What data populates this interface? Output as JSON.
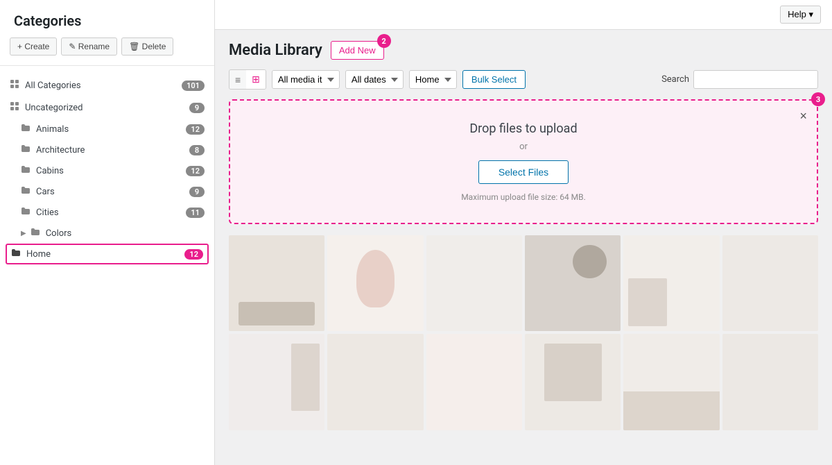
{
  "topbar": {
    "help_label": "Help ▾"
  },
  "sidebar": {
    "title": "Categories",
    "buttons": {
      "create": "+ Create",
      "rename": "✎ Rename",
      "delete": "🗑 Delete"
    },
    "items": [
      {
        "id": "all-categories",
        "label": "All Categories",
        "count": "101",
        "count_color": "gray",
        "indent": false,
        "has_arrow": false
      },
      {
        "id": "uncategorized",
        "label": "Uncategorized",
        "count": "9",
        "count_color": "gray",
        "indent": false,
        "has_arrow": false
      },
      {
        "id": "animals",
        "label": "Animals",
        "count": "12",
        "count_color": "gray",
        "indent": true,
        "has_arrow": false
      },
      {
        "id": "architecture",
        "label": "Architecture",
        "count": "8",
        "count_color": "gray",
        "indent": true,
        "has_arrow": false
      },
      {
        "id": "cabins",
        "label": "Cabins",
        "count": "12",
        "count_color": "gray",
        "indent": true,
        "has_arrow": false
      },
      {
        "id": "cars",
        "label": "Cars",
        "count": "9",
        "count_color": "gray",
        "indent": true,
        "has_arrow": false
      },
      {
        "id": "cities",
        "label": "Cities",
        "count": "11",
        "count_color": "gray",
        "indent": true,
        "has_arrow": false
      },
      {
        "id": "colors",
        "label": "Colors",
        "count": "",
        "count_color": "gray",
        "indent": true,
        "has_arrow": true
      },
      {
        "id": "home",
        "label": "Home",
        "count": "12",
        "count_color": "pink",
        "indent": true,
        "has_arrow": false,
        "active": true
      }
    ]
  },
  "page_header": {
    "title": "Media Library",
    "add_new_label": "Add New",
    "add_new_badge": "2"
  },
  "toolbar": {
    "view_list_label": "≡",
    "view_grid_label": "⊞",
    "media_filter_options": [
      "All media it"
    ],
    "media_filter_value": "All media it",
    "date_filter_options": [
      "All dates"
    ],
    "date_filter_value": "All dates",
    "category_filter_options": [
      "Home"
    ],
    "category_filter_value": "Home",
    "bulk_select_label": "Bulk Select",
    "search_label": "Search",
    "search_placeholder": ""
  },
  "upload_area": {
    "drop_text": "Drop files to upload",
    "or_text": "or",
    "select_files_label": "Select Files",
    "max_size_text": "Maximum upload file size: 64 MB.",
    "badge": "3",
    "close_label": "×"
  },
  "media_grid": {
    "items": [
      {
        "id": 1,
        "class": "ph-1"
      },
      {
        "id": 2,
        "class": "ph-2"
      },
      {
        "id": 3,
        "class": "ph-3"
      },
      {
        "id": 4,
        "class": "ph-4"
      },
      {
        "id": 5,
        "class": "ph-5"
      },
      {
        "id": 6,
        "class": "ph-6"
      },
      {
        "id": 7,
        "class": "ph-7"
      },
      {
        "id": 8,
        "class": "ph-8"
      },
      {
        "id": 9,
        "class": "ph-9"
      },
      {
        "id": 10,
        "class": "ph-10"
      },
      {
        "id": 11,
        "class": "ph-11"
      },
      {
        "id": 12,
        "class": "ph-12"
      }
    ]
  },
  "colors": {
    "accent": "#e91e8c",
    "link": "#0073aa"
  }
}
